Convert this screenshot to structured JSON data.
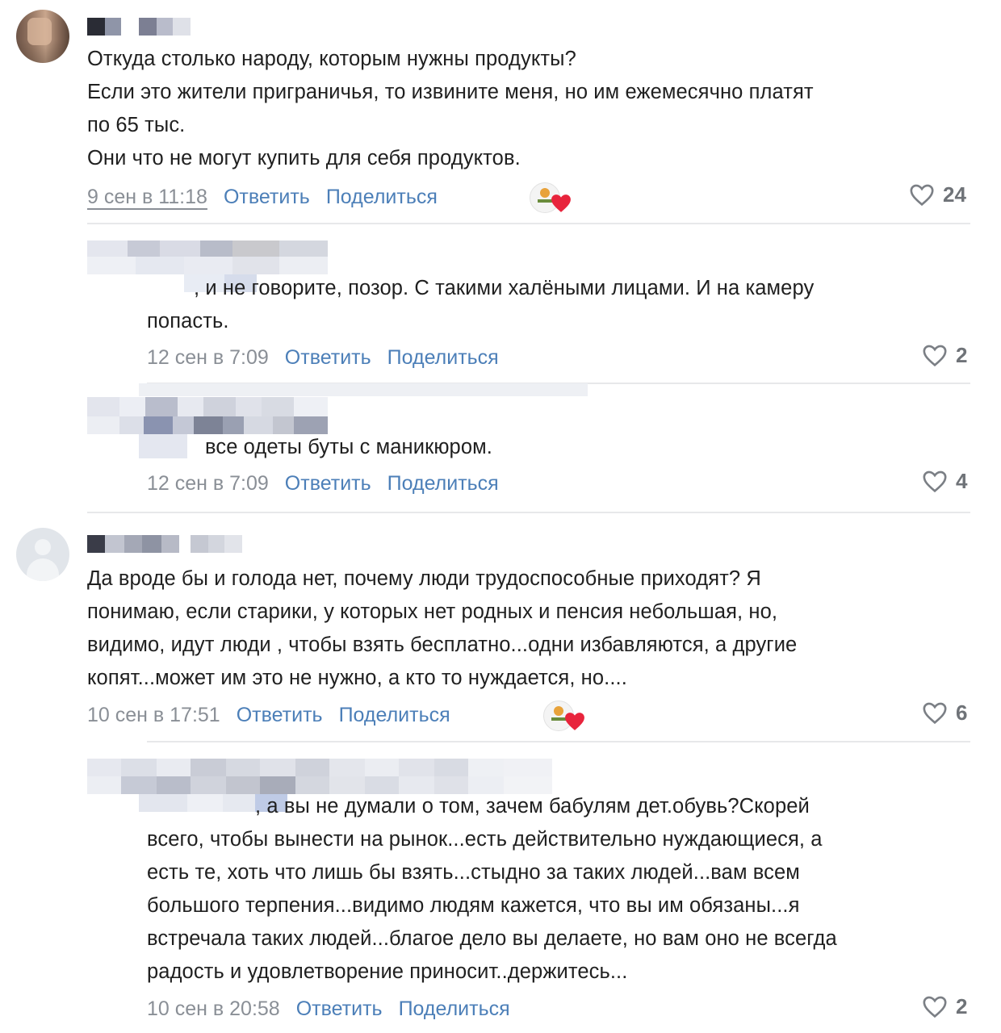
{
  "comments": [
    {
      "text": "Откуда столько народу, которым нужны продукты?\nЕсли это жители приграничья, то извините меня, но им ежемесячно платят\nпо 65 тыс.\nОни что не могут купить для себя продуктов.",
      "date": "9 сен в 11:18",
      "reply": "Ответить",
      "share": "Поделиться",
      "likes": "24"
    },
    {
      "text": ", и не говорите, позор. С такими халёными лицами. И на камеру\nпопасть.",
      "date": "12 сен в 7:09",
      "reply": "Ответить",
      "share": "Поделиться",
      "likes": "2"
    },
    {
      "text": "все одеты буты с маникюром.",
      "date": "12 сен в 7:09",
      "reply": "Ответить",
      "share": "Поделиться",
      "likes": "4"
    },
    {
      "text": "Да вроде бы и голода нет, почему люди трудоспособные приходят? Я\nпонимаю, если старики, у которых нет родных и пенсия небольшая, но,\nвидимо, идут люди , чтобы взять бесплатно...одни избавляются, а другие\nкопят...может им это не нужно, а кто то нуждается, но....",
      "date": "10 сен в 17:51",
      "reply": "Ответить",
      "share": "Поделиться",
      "likes": "6"
    },
    {
      "text_first": ", а вы не думали о том, зачем бабулям дет.обувь?Скорей",
      "text": "всего, чтобы вынести на рынок...есть действительно нуждающиеся, а\nесть те, хоть что лишь бы взять...стыдно за таких людей...вам всем\nбольшого терпения...видимо людям кажется, что вы им обязаны...я\nвстречала таких людей...благое дело вы делаете, но вам оно не всегда\nрадость и удовлетворение приносит..держитесь...",
      "date": "10 сен в 20:58",
      "reply": "Ответить",
      "share": "Поделиться",
      "likes": "2"
    }
  ],
  "colors": {
    "link": "#4c7fb8",
    "meta": "#8a8f96",
    "likes": "#6f7378",
    "reaction_heart": "#e8243c"
  },
  "icons": [
    "heart-outline-icon",
    "reaction-sticker-icon",
    "avatar-placeholder-icon"
  ]
}
